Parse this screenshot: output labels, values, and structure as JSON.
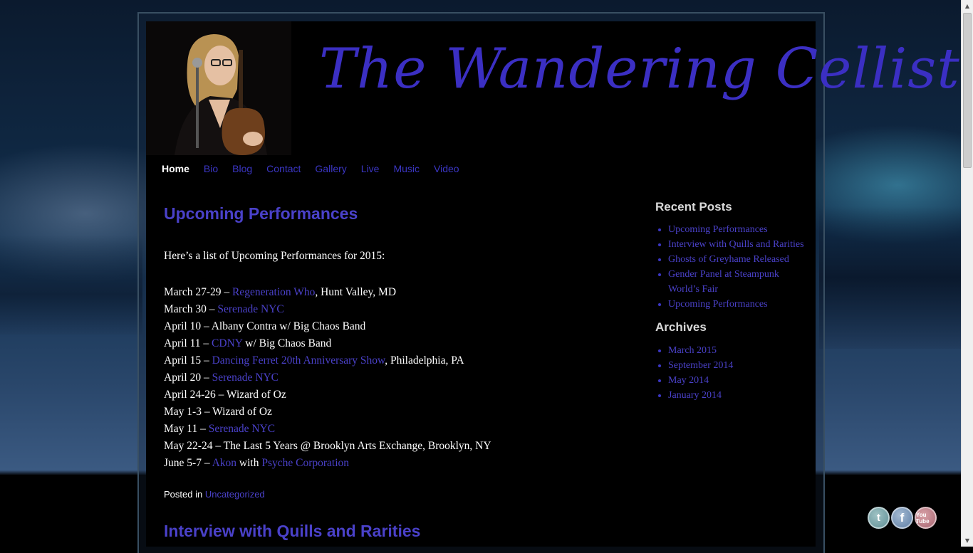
{
  "site": {
    "title": "The Wandering Cellist"
  },
  "nav": {
    "items": [
      {
        "label": "Home",
        "active": true
      },
      {
        "label": "Bio"
      },
      {
        "label": "Blog"
      },
      {
        "label": "Contact"
      },
      {
        "label": "Gallery"
      },
      {
        "label": "Live"
      },
      {
        "label": "Music"
      },
      {
        "label": "Video"
      }
    ]
  },
  "post": {
    "title": "Upcoming Performances",
    "intro": "Here’s a list of Upcoming Performances for 2015:",
    "events": [
      {
        "before": "March 27-29 – ",
        "link": "Regeneration Who",
        "after": ", Hunt Valley, MD"
      },
      {
        "before": "March 30 – ",
        "link": "Serenade NYC",
        "after": ""
      },
      {
        "before": "April 10 – Albany Contra w/ Big Chaos Band",
        "link": "",
        "after": ""
      },
      {
        "before": "April 11 – ",
        "link": "CDNY",
        "after": " w/ Big Chaos Band"
      },
      {
        "before": "April 15 – ",
        "link": "Dancing Ferret 20th Anniversary Show",
        "after": ", Philadelphia, PA"
      },
      {
        "before": "April 20 – ",
        "link": "Serenade NYC",
        "after": ""
      },
      {
        "before": "April 24-26 – Wizard of Oz",
        "link": "",
        "after": ""
      },
      {
        "before": "May 1-3 – Wizard of Oz",
        "link": "",
        "after": ""
      },
      {
        "before": "May 11 – ",
        "link": "Serenade NYC",
        "after": ""
      },
      {
        "before": "May 22-24 – The Last 5 Years @ Brooklyn Arts Exchange, Brooklyn, NY",
        "link": "",
        "after": ""
      },
      {
        "before": "June 5-7 – ",
        "link": "Akon",
        "after": " with ",
        "link2": "Psyche Corporation"
      }
    ],
    "posted_in_label": "Posted in",
    "category": "Uncategorized"
  },
  "next_post": {
    "title": "Interview with Quills and Rarities"
  },
  "sidebar": {
    "recent_title": "Recent Posts",
    "recent": [
      "Upcoming Performances",
      "Interview with Quills and Rarities",
      "Ghosts of Greyhame Released",
      "Gender Panel at Steampunk World’s Fair",
      "Upcoming Performances"
    ],
    "archives_title": "Archives",
    "archives": [
      "March 2015",
      "September 2014",
      "May 2014",
      "January 2014"
    ]
  },
  "social": {
    "icons": [
      "twitter-icon",
      "facebook-icon",
      "youtube-icon"
    ],
    "twitter_glyph": "t",
    "facebook_glyph": "f",
    "youtube_glyph": "You Tube"
  },
  "colors": {
    "link": "#4a41c9",
    "title": "#3b2fc3",
    "background": "#000000"
  }
}
